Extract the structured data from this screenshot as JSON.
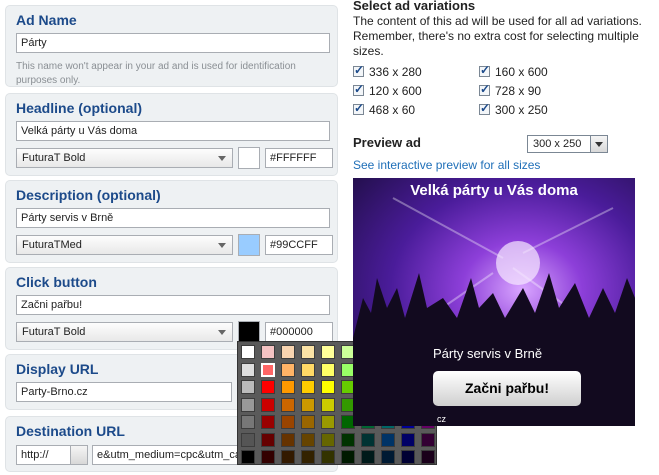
{
  "ad_name": {
    "title": "Ad Name",
    "value": "Párty",
    "hint": "This name won't appear in your ad and is used for identification purposes only."
  },
  "headline": {
    "title": "Headline (optional)",
    "value": "Velká párty u Vás doma",
    "font": "FuturaT Bold",
    "color_hex": "#FFFFFF",
    "swatch": "#FFFFFF"
  },
  "description": {
    "title": "Description (optional)",
    "value": "Párty servis v Brně",
    "font": "FuturaTMed",
    "color_hex": "#99CCFF",
    "swatch": "#99CCFF"
  },
  "click_button": {
    "title": "Click button",
    "value": "Začni pařbu!",
    "font": "FuturaT Bold",
    "color_hex": "#000000",
    "swatch": "#000000"
  },
  "display_url": {
    "title": "Display URL",
    "value": "Party-Brno.cz"
  },
  "destination_url": {
    "title": "Destination URL",
    "protocol": "http://",
    "value": "e&utm_medium=cpc&utm_cam"
  },
  "variations": {
    "title": "Select ad variations",
    "description": "The content of this ad will be used for all ad variations.\nRemember, there's no extra cost for selecting multiple\nsizes.",
    "sizes": [
      "336 x 280",
      "160 x 600",
      "120 x 600",
      "728 x 90",
      "468 x 60",
      "300 x 250"
    ]
  },
  "preview": {
    "label": "Preview ad",
    "size": "300 x 250",
    "link": "See interactive preview for all sizes",
    "ad": {
      "headline": "Velká párty u Vás doma",
      "description": "Párty servis v Brně",
      "button": "Začni pařbu!",
      "url_fragment": "cz"
    }
  },
  "palette": {
    "colors": [
      [
        "#ffffff",
        "#f4c2c2",
        "#f8d4b0",
        "#fbe3a6",
        "#ffff99",
        "#ccff99",
        "#99ffcc",
        "#ccffff",
        "#ccccff",
        "#ffccff"
      ],
      [
        "#dddddd",
        "#ff6666",
        "#ffb366",
        "#ffd966",
        "#ffff66",
        "#99ff66",
        "#66ffb3",
        "#66ffff",
        "#9999ff",
        "#ff99ff"
      ],
      [
        "#bbbbbb",
        "#ff0000",
        "#ff9900",
        "#ffcc00",
        "#ffff00",
        "#66cc00",
        "#33cc99",
        "#33cccc",
        "#6666ff",
        "#cc66cc"
      ],
      [
        "#999999",
        "#cc0000",
        "#cc6600",
        "#cc9900",
        "#cccc00",
        "#339900",
        "#009966",
        "#009999",
        "#3333cc",
        "#993399"
      ],
      [
        "#777777",
        "#990000",
        "#994400",
        "#996600",
        "#999900",
        "#006600",
        "#006633",
        "#006666",
        "#000099",
        "#660066"
      ],
      [
        "#555555",
        "#660000",
        "#663300",
        "#664400",
        "#666600",
        "#003300",
        "#003333",
        "#003366",
        "#000066",
        "#330033"
      ],
      [
        "#000000",
        "#330000",
        "#331a00",
        "#332200",
        "#333300",
        "#001a00",
        "#001a1a",
        "#001a33",
        "#000033",
        "#1a001a"
      ]
    ],
    "selected": [
      1,
      1
    ]
  }
}
